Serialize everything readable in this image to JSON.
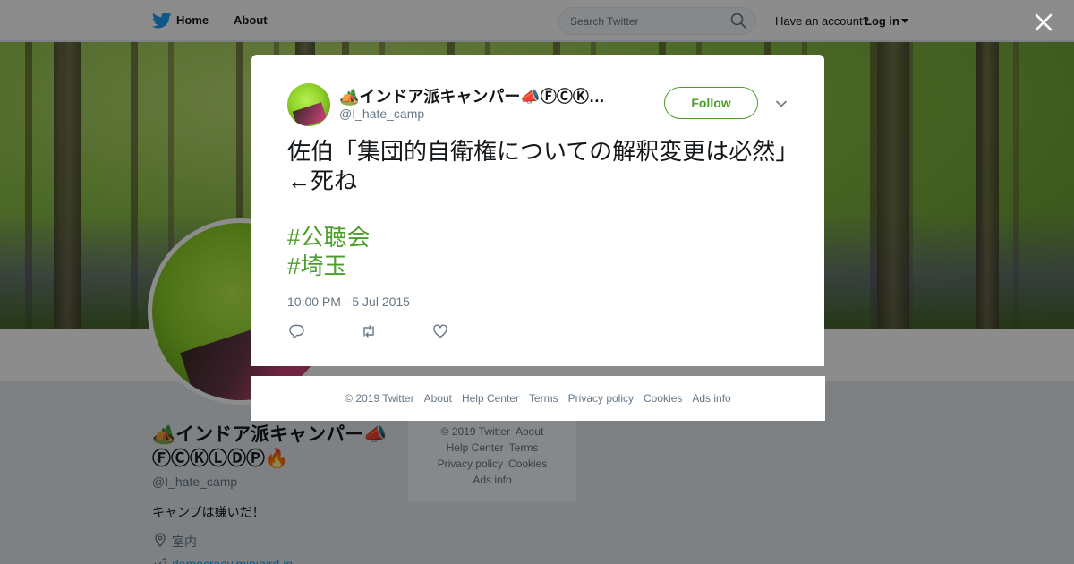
{
  "nav": {
    "home": "Home",
    "about": "About",
    "search_placeholder": "Search Twitter",
    "have_account": "Have an account?",
    "login": "Log in"
  },
  "profile": {
    "name": "🏕️インドア派キャンパー📣ⒻⒸⓀⓁⒹⓅ🔥",
    "handle": "@I_hate_camp",
    "bio": "キャンプは嫌いだ！",
    "location": "室内",
    "link": "democracy.minibird.jp"
  },
  "side_footer": {
    "copyright": "© 2019 Twitter",
    "about": "About",
    "help_center": "Help Center",
    "terms": "Terms",
    "privacy": "Privacy policy",
    "cookies": "Cookies",
    "ads_info": "Ads info"
  },
  "tweet": {
    "name": "🏕️インドア派キャンパー📣ⒻⒸⓀⓁⒹⓅ🔥",
    "handle": "@I_hate_camp",
    "follow": "Follow",
    "text": "佐伯「集団的自衛権についての解釈変更は必然」←死ね",
    "hashtags": [
      "#公聴会",
      "#埼玉"
    ],
    "timestamp": "10:00 PM - 5 Jul 2015"
  },
  "modal_footer": {
    "copyright": "© 2019 Twitter",
    "about": "About",
    "help_center": "Help Center",
    "terms": "Terms",
    "privacy": "Privacy policy",
    "cookies": "Cookies",
    "ads_info": "Ads info"
  },
  "colors": {
    "accent_green": "#4a9e2a",
    "twitter_blue": "#1da1f2",
    "muted_text": "#657786"
  },
  "icons": [
    "twitter-bird-icon",
    "search-icon",
    "chevron-down-icon",
    "close-icon",
    "location-pin-icon",
    "link-icon",
    "reply-icon",
    "retweet-icon",
    "like-heart-icon"
  ]
}
